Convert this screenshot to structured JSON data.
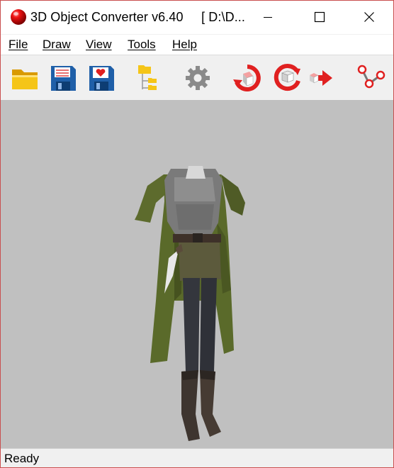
{
  "window": {
    "title": "3D Object Converter v6.40     [ D:\\D..."
  },
  "icons": {
    "app": "red-sphere-icon",
    "minimize": "minimize-icon",
    "maximize": "maximize-icon",
    "close": "close-icon"
  },
  "menu": {
    "file": "File",
    "draw": "Draw",
    "view": "View",
    "tools": "Tools",
    "help": "Help"
  },
  "toolbar": {
    "buttons": [
      {
        "name": "open-folder-icon"
      },
      {
        "name": "save-icon"
      },
      {
        "name": "save-favorite-icon"
      },
      {
        "name": "folder-tree-icon"
      },
      {
        "name": "settings-gear-icon"
      },
      {
        "name": "rotate-object-icon"
      },
      {
        "name": "rotate-cube-icon"
      },
      {
        "name": "convert-arrow-icon"
      },
      {
        "name": "connect-nodes-icon"
      }
    ]
  },
  "viewport": {
    "background": "#c0c0c0",
    "model": "armored-outfit-model"
  },
  "status": {
    "text": "Ready"
  },
  "colors": {
    "window_border": "#c94f4f",
    "accent_red": "#e02020",
    "folder_yellow": "#f5c518",
    "floppy_blue": "#1f5fa8"
  }
}
